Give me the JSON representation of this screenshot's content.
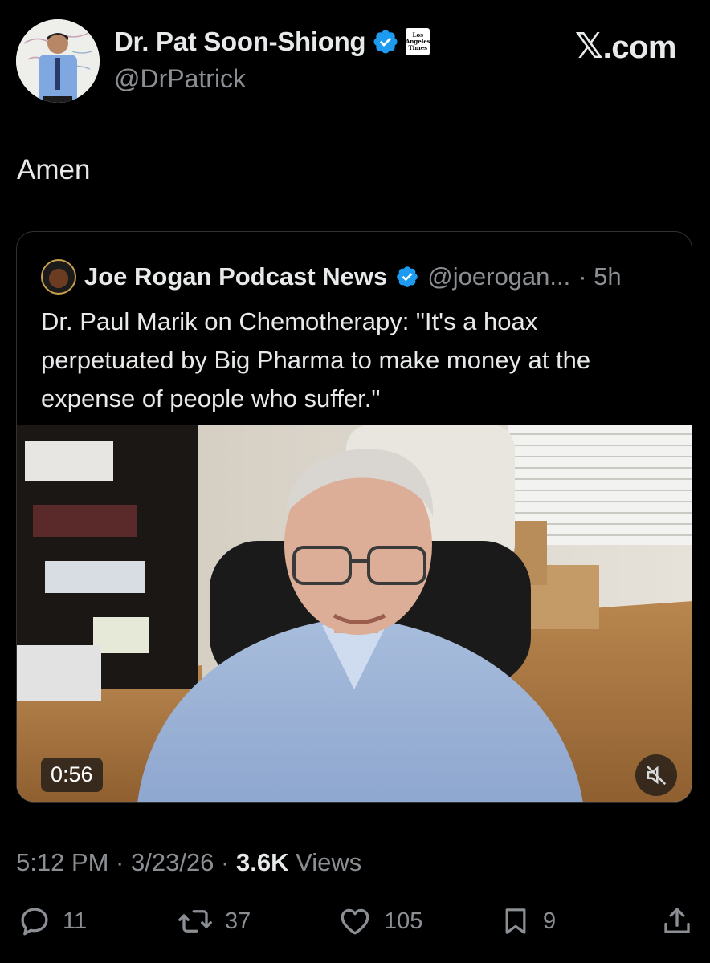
{
  "author": {
    "display_name": "Dr. Pat Soon-Shiong",
    "handle": "@DrPatrick",
    "affiliation_badge_text": [
      "Los",
      "Angeles",
      "Times"
    ]
  },
  "site_label": "X.com",
  "post": {
    "text": "Amen",
    "timestamp": "5:12 PM · 3/23/26 · ",
    "views_count": "3.6K",
    "views_label": " Views"
  },
  "quoted_post": {
    "display_name": "Joe Rogan Podcast News",
    "handle": "@joerogan...",
    "time_ago": " · 5h",
    "text": "Dr. Paul Marik on Chemotherapy: \"It's a hoax perpetuated by Big Pharma to make money at the expense of people who suffer.\"",
    "video": {
      "duration": "0:56",
      "muted": true
    }
  },
  "actions": {
    "replies": "11",
    "reposts": "37",
    "likes": "105",
    "bookmarks": "9"
  },
  "colors": {
    "background": "#000000",
    "text_primary": "#e7e9ea",
    "text_secondary": "#8b8f94",
    "verified_blue": "#1d9bf0",
    "border": "#2f3336"
  },
  "icons": [
    "verified-badge-icon",
    "reply-icon",
    "repost-icon",
    "like-icon",
    "bookmark-icon",
    "share-icon",
    "mute-icon"
  ]
}
